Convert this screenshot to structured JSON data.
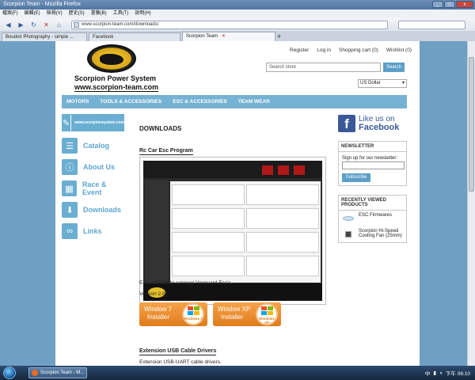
{
  "window": {
    "title": "Scorpion Team - Mozilla Firefox",
    "controls": [
      "_",
      "□",
      "x"
    ]
  },
  "menubar": [
    "檔案(F)",
    "編輯(E)",
    "檢視(V)",
    "歷史(S)",
    "書籤(B)",
    "工具(T)",
    "說明(H)"
  ],
  "navbar": {
    "url": "www.scorpion-team.com/downloads/"
  },
  "tabs": [
    {
      "label": "Boudoir Photography - simple ...",
      "active": false
    },
    {
      "label": "Facebook",
      "active": false
    },
    {
      "label": "Scorpion Team",
      "active": true
    }
  ],
  "header": {
    "brand_name": "Scorpion Power System",
    "brand_url": "www.scorpion-team.com",
    "top_links": [
      "Register",
      "Log in",
      "Shopping cart (0)",
      "Wishlist (0)"
    ],
    "search_placeholder": "Search store",
    "search_button": "Search",
    "currency": "US Dollar"
  },
  "main_nav": [
    "MOTORS",
    "TOOLS & ACCESSORIES",
    "ESC & ACCESSORIES",
    "TEAM WEAR"
  ],
  "left_menu": {
    "site_badge": "www.scorpionsystem.com",
    "items": [
      {
        "label": "Catalog",
        "icon": "catalog-icon"
      },
      {
        "label": "About Us",
        "icon": "info-icon"
      },
      {
        "label": "Race & Event",
        "icon": "calendar-icon"
      },
      {
        "label": "Downloads",
        "icon": "download-icon"
      },
      {
        "label": "Links",
        "icon": "link-icon"
      }
    ]
  },
  "content": {
    "heading": "DOWNLOADS",
    "section1_title": "Rc Car Esc Program",
    "section1_desc": "Esc software to connect Vanguard Esc's.",
    "version": "Version 2.01",
    "installers": [
      {
        "line1": "Window 7",
        "line2": "Installer",
        "badge": "Windows 7"
      },
      {
        "line1": "Window XP",
        "line2": "Installer",
        "badge": "Windows XP"
      }
    ],
    "section2_title": "Extension USB Cable Drivers",
    "section2_desc": "Extension USB-UART cable drivers."
  },
  "facebook": {
    "line1": "Like us on",
    "line2": "Facebook"
  },
  "newsletter": {
    "title": "NEWSLETTER",
    "label": "Sign up for our newsletter:",
    "button": "Subscribe"
  },
  "recent": {
    "title": "RECENTLY VIEWED PRODUCTS",
    "items": [
      "ESC Firmwares",
      "Scorpion Hi-Speed Cooling Fan (25mm)"
    ]
  },
  "taskbar": {
    "task": "Scorpion Team - M...",
    "ime": "中",
    "clock": "下午 06:10"
  },
  "colors": {
    "page_bg": "#6f9fc2",
    "nav_blue": "#75b2d3",
    "link_blue": "#5ea6cf",
    "facebook": "#3b5998",
    "installer_orange": "#e07b1b"
  }
}
